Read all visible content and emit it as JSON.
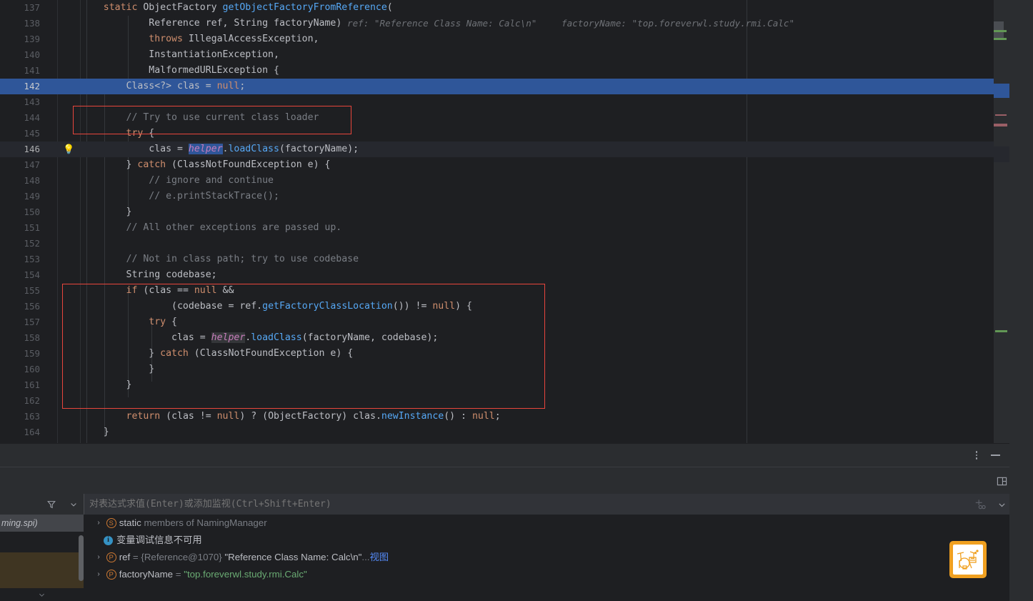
{
  "editor": {
    "language": "java",
    "first_line": 137,
    "current_line": 146,
    "selected_line": 142,
    "lines": [
      {
        "n": "137",
        "indent": 0,
        "text": "    static ObjectFactory getObjectFactoryFromReference("
      },
      {
        "n": "138",
        "indent": 0,
        "text": "            Reference ref, String factoryName)"
      },
      {
        "n": "139",
        "indent": 0,
        "text": "            throws IllegalAccessException,"
      },
      {
        "n": "140",
        "indent": 0,
        "text": "            InstantiationException,"
      },
      {
        "n": "141",
        "indent": 0,
        "text": "            MalformedURLException {"
      },
      {
        "n": "142",
        "indent": 0,
        "text": "        Class<?> clas = null;"
      },
      {
        "n": "143",
        "indent": 0,
        "text": ""
      },
      {
        "n": "144",
        "indent": 0,
        "text": "        // Try to use current class loader"
      },
      {
        "n": "145",
        "indent": 0,
        "text": "        try {"
      },
      {
        "n": "146",
        "indent": 0,
        "text": "            clas = helper.loadClass(factoryName);"
      },
      {
        "n": "147",
        "indent": 0,
        "text": "        } catch (ClassNotFoundException e) {"
      },
      {
        "n": "148",
        "indent": 0,
        "text": "            // ignore and continue"
      },
      {
        "n": "149",
        "indent": 0,
        "text": "            // e.printStackTrace();"
      },
      {
        "n": "150",
        "indent": 0,
        "text": "        }"
      },
      {
        "n": "151",
        "indent": 0,
        "text": "        // All other exceptions are passed up."
      },
      {
        "n": "152",
        "indent": 0,
        "text": ""
      },
      {
        "n": "153",
        "indent": 0,
        "text": "        // Not in class path; try to use codebase"
      },
      {
        "n": "154",
        "indent": 0,
        "text": "        String codebase;"
      },
      {
        "n": "155",
        "indent": 0,
        "text": "        if (clas == null &&"
      },
      {
        "n": "156",
        "indent": 0,
        "text": "                (codebase = ref.getFactoryClassLocation()) != null) {"
      },
      {
        "n": "157",
        "indent": 0,
        "text": "            try {"
      },
      {
        "n": "158",
        "indent": 0,
        "text": "                clas = helper.loadClass(factoryName, codebase);"
      },
      {
        "n": "159",
        "indent": 0,
        "text": "            } catch (ClassNotFoundException e) {"
      },
      {
        "n": "160",
        "indent": 0,
        "text": "            }"
      },
      {
        "n": "161",
        "indent": 0,
        "text": "        }"
      },
      {
        "n": "162",
        "indent": 0,
        "text": ""
      },
      {
        "n": "163",
        "indent": 0,
        "text": "        return (clas != null) ? (ObjectFactory) clas.newInstance() : null;"
      },
      {
        "n": "164",
        "indent": 0,
        "text": "    }"
      }
    ],
    "inlay_hints": [
      {
        "label": "ref: \"Reference Class Name: Calc\\n\""
      },
      {
        "label": "factoryName: \"top.foreverwl.study.rmi.Calc\""
      }
    ],
    "bulb_icon": "lightbulb-icon",
    "annotations": [
      {
        "name": "comment-highlight-box"
      },
      {
        "name": "codebase-block-highlight-box"
      }
    ]
  },
  "toolbar": {
    "more_options_icon": "vertical-dots-icon",
    "minimize_icon": "minimize-icon",
    "layout_icon": "layout-split-icon",
    "add_watch_icon": "add-watch-icon",
    "expand_icon": "chevron-down-icon"
  },
  "debug": {
    "frames": {
      "filter_icon": "filter-funnel-icon",
      "dropdown_icon": "chevron-down-icon",
      "scroll_down_icon": "chevron-down-icon",
      "items": [
        {
          "label": "ming.spi)",
          "selected": true
        },
        {
          "label": "",
          "selected": false
        }
      ]
    },
    "watch": {
      "placeholder": "对表达式求值(Enter)或添加监视(Ctrl+Shift+Enter)",
      "value": ""
    },
    "variables": [
      {
        "kind": "static",
        "expandable": true,
        "badge": "S",
        "badge_name": "static-badge-icon",
        "name": "static",
        "suffix": " members of NamingManager"
      },
      {
        "kind": "info",
        "expandable": false,
        "badge": "i",
        "badge_name": "info-badge-icon",
        "message": "变量调试信息不可用"
      },
      {
        "kind": "param",
        "expandable": true,
        "badge": "P",
        "badge_name": "parameter-badge-icon",
        "name": "ref",
        "eq": " = ",
        "ref_id": "{Reference@1070}",
        "value": "\"Reference Class Name: Calc\\n\"",
        "ellipsis": "...",
        "link": "视图"
      },
      {
        "kind": "param",
        "expandable": true,
        "badge": "P",
        "badge_name": "parameter-badge-icon",
        "name": "factoryName",
        "eq": " = ",
        "value": "\"top.foreverwl.study.rmi.Calc\""
      }
    ],
    "drumkit_icon": "drum-kit-icon"
  },
  "colors": {
    "bg": "#1E1F22",
    "panel": "#2B2D30",
    "selection": "#2F5699",
    "keyword": "#CF8E6D",
    "comment": "#7A7E85",
    "string": "#6AAB73",
    "method": "#56A8F5",
    "field": "#C77DBB",
    "accent_red": "#E8453C",
    "accent_orange": "#F0A020",
    "link": "#548AF7"
  }
}
